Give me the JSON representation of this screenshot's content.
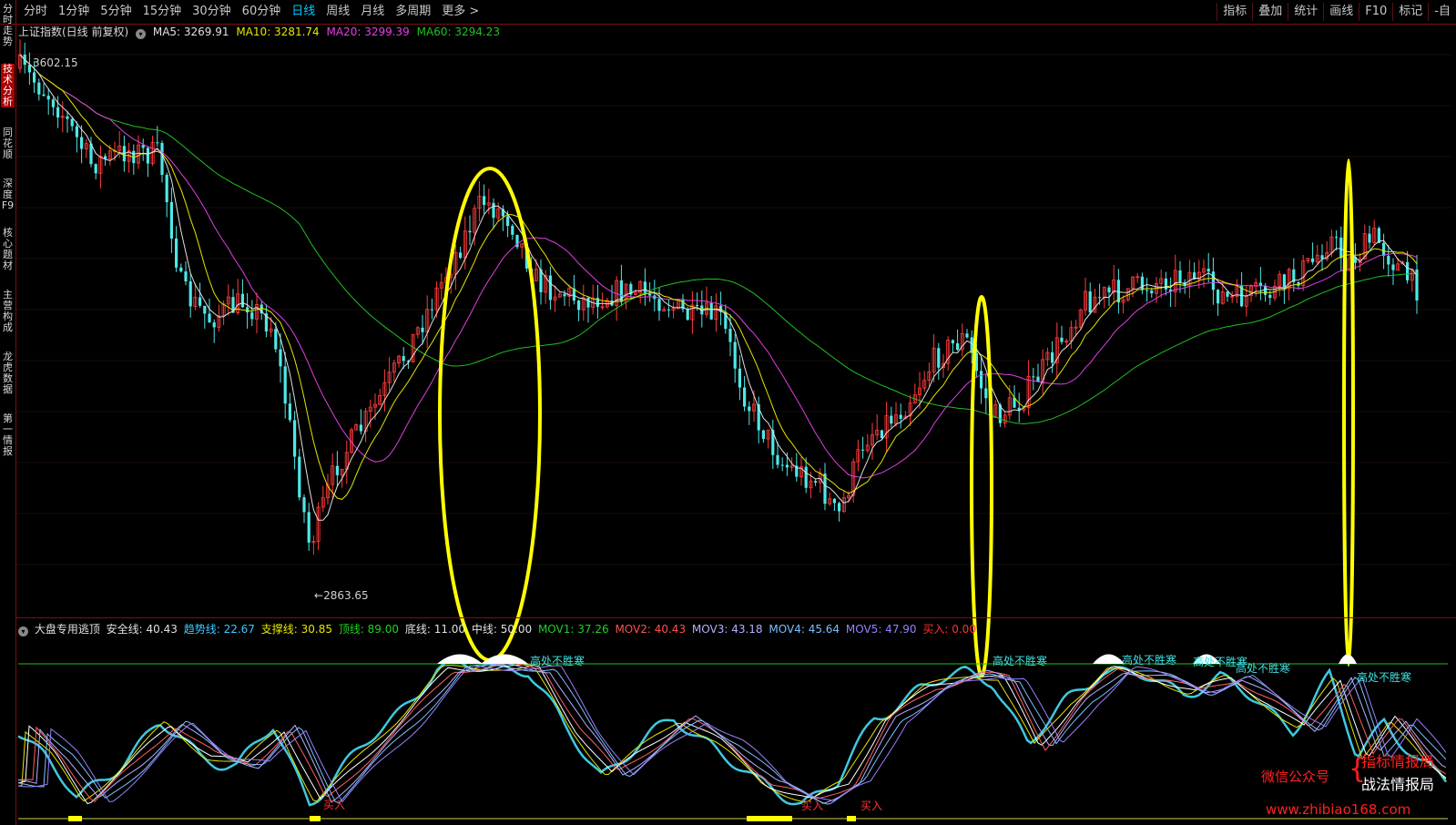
{
  "period_tabs": [
    "分时",
    "1分钟",
    "5分钟",
    "15分钟",
    "30分钟",
    "60分钟",
    "日线",
    "周线",
    "月线",
    "多周期",
    "更多 >"
  ],
  "active_period": "日线",
  "tools": [
    "指标",
    "叠加",
    "统计",
    "画线",
    "F10",
    "标记",
    "-自"
  ],
  "sidebar": [
    "分时走势",
    "技术分析",
    "同花顺",
    "深度F9",
    "核心题材",
    "主营构成",
    "龙虎数据",
    "第一情报"
  ],
  "main_legend": {
    "title": "上证指数(日线 前复权)",
    "ma5": "MA5: 3269.91",
    "ma10": "MA10: 3281.74",
    "ma20": "MA20: 3299.39",
    "ma60": "MA60: 3294.23"
  },
  "price_labels": {
    "high": "3602.15",
    "low": "2863.65"
  },
  "sub_legend": {
    "name": "大盘专用逃顶",
    "safe": "安全线: 40.43",
    "trend": "趋势线: 22.67",
    "support": "支撑线: 30.85",
    "top": "顶线: 89.00",
    "bottom": "底线: 11.00",
    "mid": "中线: 50.00",
    "mov1": "MOV1: 37.26",
    "mov2": "MOV2: 40.43",
    "mov3": "MOV3: 43.18",
    "mov4": "MOV4: 45.64",
    "mov5": "MOV5: 47.90",
    "buy": "买入: 0.00"
  },
  "annotations": {
    "top_warning": "高处不胜寒",
    "buy": "买入"
  },
  "watermark": {
    "wechat": "微信公众号",
    "line1": "指标情报局",
    "line2": "战法情报局",
    "url": "www.zhibiao168.com"
  },
  "colors": {
    "up": "#ff3b3b",
    "down": "#4ee8e8",
    "ma5": "#e0e0e0",
    "ma10": "#e6e600",
    "ma20": "#e040e0",
    "ma60": "#20c020",
    "highlight": "#ffff00",
    "top_line": "#20c020"
  }
}
